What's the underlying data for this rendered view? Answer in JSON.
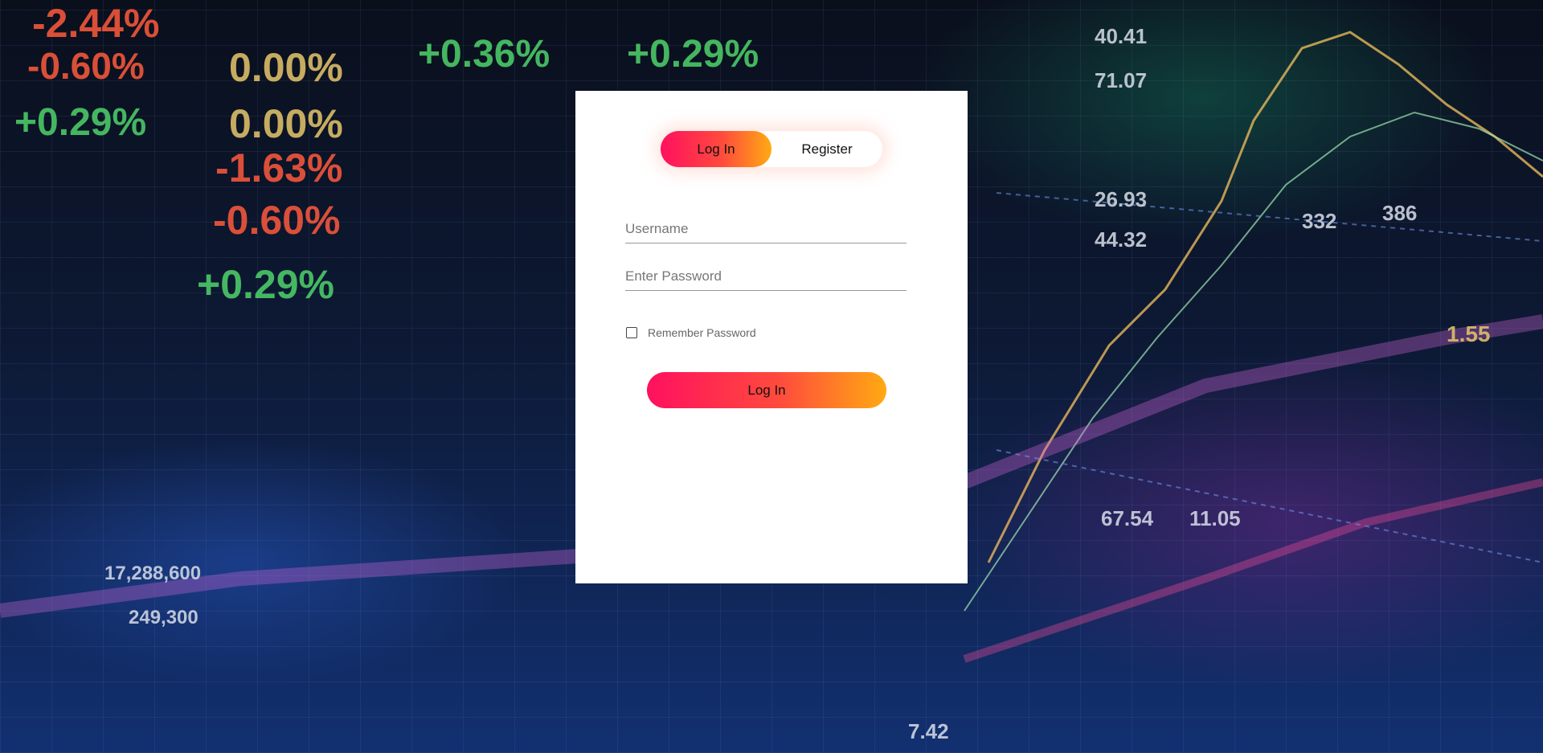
{
  "auth_toggle": {
    "login_label": "Log In",
    "register_label": "Register",
    "active": "login"
  },
  "form": {
    "username_placeholder": "Username",
    "username_value": "",
    "password_placeholder": "Enter Password",
    "password_value": "",
    "remember_label": "Remember Password",
    "remember_checked": false,
    "submit_label": "Log In"
  },
  "colors": {
    "accent_start": "#ff105f",
    "accent_end": "#ffaa12",
    "panel_bg": "#ffffff"
  }
}
